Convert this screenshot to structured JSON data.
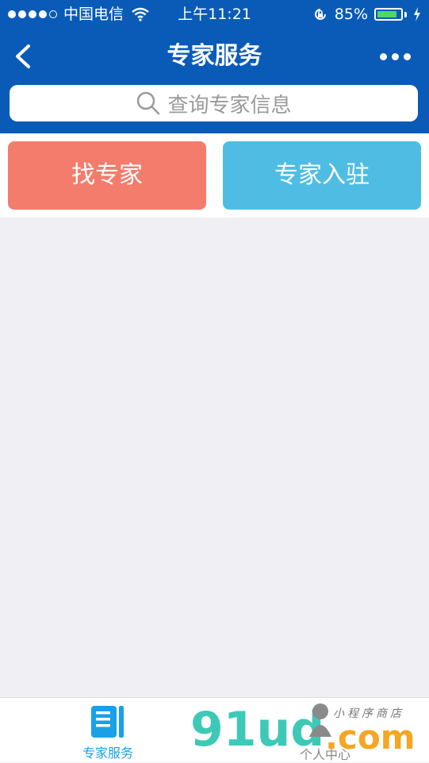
{
  "status_bar": {
    "carrier": "中国电信",
    "time": "上午11:21",
    "battery_percent": "85%",
    "battery_level": 0.85
  },
  "navbar": {
    "title": "专家服务"
  },
  "search": {
    "placeholder": "查询专家信息"
  },
  "actions": {
    "find_expert": "找专家",
    "expert_join": "专家入驻"
  },
  "tabbar": {
    "items": [
      {
        "label": "专家服务",
        "active": true
      },
      {
        "label": "个人中心",
        "active": false
      }
    ]
  },
  "watermark": {
    "logo": "91ud",
    "domain": ".com",
    "text": "小程序商店"
  },
  "colors": {
    "primary": "#0a5bb8",
    "find_button": "#f47c6c",
    "join_button": "#4fbde3",
    "tab_active": "#1aa0e6"
  }
}
